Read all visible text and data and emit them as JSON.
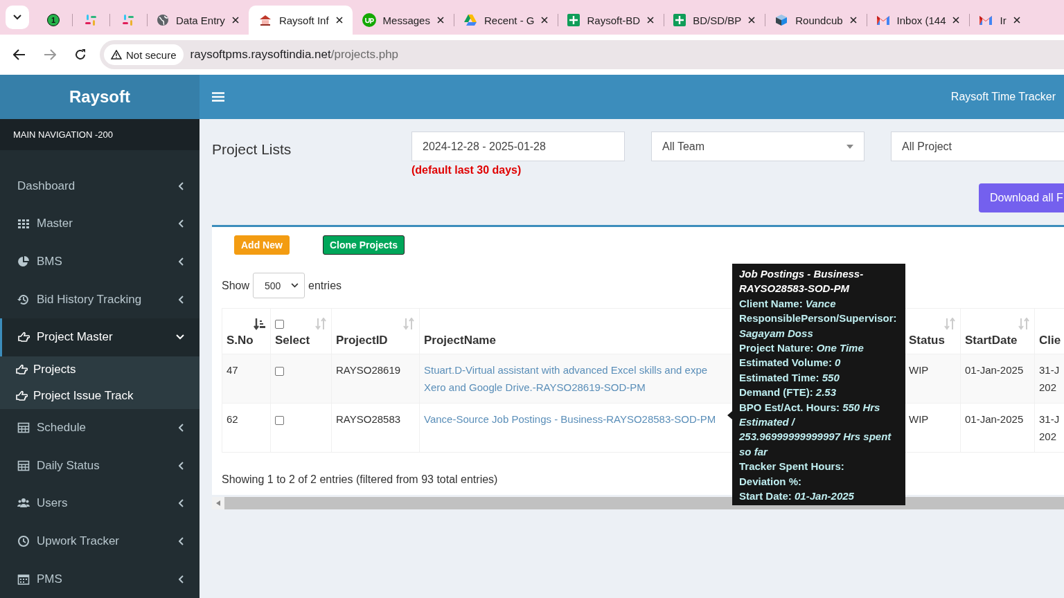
{
  "browser": {
    "tabs": [
      {
        "badge": "1",
        "selected": false
      },
      {
        "selected": false
      },
      {
        "selected": false
      },
      {
        "title": "Data Entry",
        "selected": false
      },
      {
        "title": "Raysoft Inf",
        "selected": true
      },
      {
        "title": "Messages",
        "selected": false
      },
      {
        "title": "Recent - G",
        "selected": false
      },
      {
        "title": "Raysoft-BD",
        "selected": false
      },
      {
        "title": "BD/SD/BP",
        "selected": false
      },
      {
        "title": "Roundcub",
        "selected": false
      },
      {
        "title": "Inbox (144",
        "selected": false
      },
      {
        "title": "Ir",
        "selected": false
      }
    ],
    "security": "Not secure",
    "url_host": "raysoftpms.raysoftindia.net",
    "url_path": "/projects.php"
  },
  "app": {
    "logo": "Raysoft",
    "header_title": "Raysoft Time Tracker"
  },
  "sidebar": {
    "heading": "MAIN NAVIGATION -200",
    "items": [
      {
        "label": "Dashboard",
        "selected": false,
        "expanded": false
      },
      {
        "label": "Master",
        "selected": false,
        "expanded": false
      },
      {
        "label": "BMS",
        "selected": false,
        "expanded": false
      },
      {
        "label": "Bid History Tracking",
        "selected": false,
        "expanded": false
      },
      {
        "label": "Project Master",
        "selected": true,
        "expanded": true,
        "children": [
          {
            "label": "Projects",
            "selected": false
          },
          {
            "label": "Project Issue Track",
            "selected": false
          }
        ]
      },
      {
        "label": "Schedule",
        "selected": false,
        "expanded": false
      },
      {
        "label": "Daily Status",
        "selected": false,
        "expanded": false
      },
      {
        "label": "Users",
        "selected": false,
        "expanded": false
      },
      {
        "label": "Upwork Tracker",
        "selected": false,
        "expanded": false
      },
      {
        "label": "PMS",
        "selected": false,
        "expanded": false
      }
    ]
  },
  "content": {
    "page_title": "Project Lists",
    "date_range": "2024-12-28 - 2025-01-28",
    "date_hint": "(default last 30 days)",
    "team_select": "All Team",
    "project_select": "All Project",
    "download_button": "Download all F",
    "add_button": "Add New",
    "clone_button": "Clone Projects",
    "show_label": "Show",
    "page_size": "500",
    "entries_label": "entries",
    "table": {
      "header_checked": false,
      "columns": [
        {
          "label": "S.No",
          "sortable": true,
          "sorted": true
        },
        {
          "label": "Select",
          "sortable": true,
          "sorted": false
        },
        {
          "label": "ProjectID",
          "sortable": true,
          "sorted": false
        },
        {
          "label": "ProjectName",
          "sortable": false
        },
        {},
        {
          "label": "Status",
          "sortable": true,
          "sorted": false
        },
        {
          "label": "StartDate",
          "sortable": true,
          "sorted": false
        },
        {
          "label": "Clie"
        }
      ],
      "rows": [
        {
          "sno": "47",
          "checked": false,
          "project_id": "RAYSO28619",
          "name_lines": [
            "Stuart.D-Virtual assistant with advanced Excel skills and expe",
            "Xero and Google Drive.-RAYSO28619-SOD-PM"
          ],
          "status": "WIP",
          "start_date": "01-Jan-2025",
          "client_lines": [
            "31-J",
            "202"
          ]
        },
        {
          "sno": "62",
          "checked": false,
          "project_id": "RAYSO28583",
          "name_lines": [
            "Vance-Source Job Postings - Business-RAYSO28583-SOD-PM"
          ],
          "status": "WIP",
          "start_date": "01-Jan-2025",
          "client_lines": [
            "31-J",
            "202"
          ]
        }
      ]
    },
    "info": "Showing 1 to 2 of 2 entries (filtered from 93 total entries)",
    "tooltip": {
      "title": "Job Postings - Business-RAYSO28583-SOD-PM",
      "fields": [
        "Client Name: *Vance*",
        "ResponsiblePerson/Supervisor: *Sagayam Doss*",
        "Project Nature: *One Time*",
        "Estimated Volume: *0*",
        "Estimated Time: *550*",
        "Demand (FTE): *2.53*",
        "BPO Est/Act. Hours: *550 Hrs Estimated / 253.96999999999997 Hrs spent so far*",
        "Tracker Spent Hours:",
        "Deviation %:",
        "Start Date: *01-Jan-2025*"
      ]
    }
  }
}
